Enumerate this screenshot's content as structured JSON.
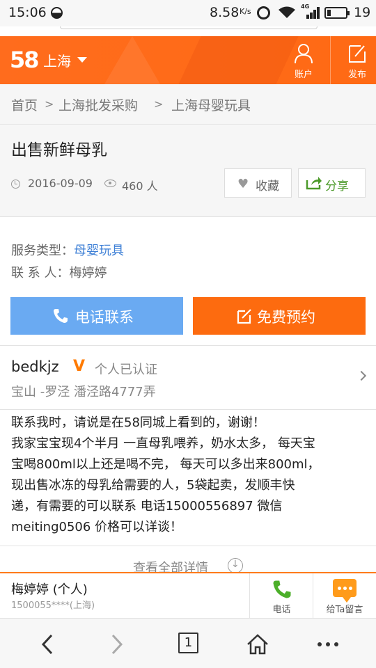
{
  "status_bar": {
    "time": "15:06",
    "net_speed": "8.58",
    "net_speed_unit": "K/s",
    "network_type": "4G",
    "battery_level_percent": 19,
    "battery_text": "19"
  },
  "header": {
    "logo": "58",
    "city": "上海",
    "account_label": "账户",
    "publish_label": "发布",
    "brand_color": "#ff6a14"
  },
  "breadcrumb": {
    "items": [
      "首页",
      "上海批发采购",
      "上海母婴玩具"
    ],
    "separator": ">"
  },
  "listing": {
    "title": "出售新鲜母乳",
    "date": "2016-09-09",
    "views": "460 人",
    "favorite_label": "收藏",
    "share_label": "分享"
  },
  "info": {
    "service_type_label": "服务类型：",
    "service_type_value": "母婴玩具",
    "contact_label": "联 系 人：",
    "contact_value": "梅婷婷",
    "call_button": "电话联系",
    "book_button": "免费预约",
    "call_color": "#6aaaf2",
    "book_color": "#fd6b0f"
  },
  "seller": {
    "username": "bedkjz",
    "verified_mark": "V",
    "verified_text": "个人已认证",
    "address": "宝山 -罗泾 潘泾路4777弄"
  },
  "description": {
    "lines": [
      "联系我时，请说是在58同城上看到的，谢谢！",
      "我家宝宝现4个半月 一直母乳喂养，奶水太多， 每天宝",
      "宝喝800ml以上还是喝不完， 每天可以多出来800ml，",
      "现出售冰冻的母乳给需要的人，5袋起卖，发顺丰快",
      "递，有需要的可以联系 电话15000556897  微信",
      "meiting0506  价格可以详谈！"
    ],
    "more_label": "查看全部详情"
  },
  "contact_bar": {
    "name": "梅婷婷 (个人)",
    "phone": "1500055****(上海)",
    "phone_button": "电话",
    "message_button": "给Ta留言"
  },
  "browser_nav": {
    "tab_count": "1"
  }
}
